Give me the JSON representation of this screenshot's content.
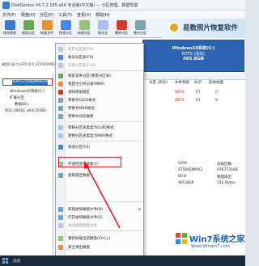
{
  "window": {
    "title": "DiskGenius V4.7.2.155 x64 专业版(中文版) — 分区管理、数据恢复"
  },
  "menubar": [
    "文件(F)",
    "硬盘(D)",
    "分区(P)",
    "工具(T)",
    "查看(V)",
    "帮助(H)"
  ],
  "toolbar": [
    "保存更改",
    "搜索分区",
    "恢复文件",
    "快速分区",
    "新建分区",
    "格式化",
    "删除分区",
    "备份分区"
  ],
  "banner": {
    "text": "易数照片恢复软件"
  },
  "disk_info": "硬盘0 接口:SATA 型号:ST500DM002 容量:465.8GB",
  "partition_bar": {
    "line1": "Windows10系统(C:)",
    "line2": "NTFS (活动)",
    "line3": "465.8GB"
  },
  "tree": {
    "disk0": "HD0:ST500DM002(466GB)",
    "items": [
      "Windows10系统(C:)",
      "扩展分区",
      "数据(D:)",
      "RD1:18501 x64(15GB)"
    ]
  },
  "grid": {
    "headers": [
      "分区 (状态)",
      "文件系统",
      "标识",
      "起始柱面"
    ],
    "rows": [
      {
        "fs": "NTFS",
        "id": "07",
        "start": "0"
      },
      {
        "fs": "NTFS",
        "id": "07",
        "start": "9"
      }
    ]
  },
  "details": {
    "labels": [
      "SATA",
      "ST500DM002",
      "60.8",
      "465.8GB"
    ],
    "values": [
      "总扇区数:",
      "976773168",
      "物理扇区:",
      "512 Bytes"
    ]
  },
  "context_menu": {
    "items": [
      {
        "label": "保存分区表(F8)",
        "enabled": false
      },
      {
        "label": "备份分区表(F9)",
        "enabled": true
      },
      {
        "label": "还原分区表(F10)",
        "enabled": false
      },
      {
        "label": "搜索丢失分区(重建分区表)",
        "enabled": true
      },
      {
        "label": "重建主引导记录(MBR)",
        "enabled": true
      },
      {
        "label": "清除保留扇区",
        "enabled": true
      },
      {
        "label": "转换为GUID格式",
        "enabled": true
      },
      {
        "label": "转换为MBR格式",
        "enabled": true
      },
      {
        "label": "转换为动态磁盘",
        "enabled": true
      },
      {
        "label": "转换分区表类型为GUID格式",
        "enabled": true
      },
      {
        "label": "转换分区表类型为MBR格式",
        "enabled": true
      },
      {
        "label": "快速分区(F6)",
        "enabled": true
      },
      {
        "label": "坏道检测与修复(Y)",
        "enabled": true
      },
      {
        "label": "复制扇区数据",
        "enabled": true
      },
      {
        "label": "新建虚拟磁盘文件(N)",
        "enabled": true
      },
      {
        "label": "打开虚拟磁盘文件(V)",
        "enabled": true
      },
      {
        "label": "关闭虚拟磁盘文件",
        "enabled": false
      },
      {
        "label": "重新加载当前硬盘(Ctrl_L)",
        "enabled": true
      },
      {
        "label": "安全弹出磁盘",
        "enabled": true
      }
    ]
  },
  "status": "就绪",
  "watermark": {
    "brand": "Win7系统之家",
    "url": "Www.Winwin7.com"
  },
  "colors": {
    "highlight": "#e02020",
    "partition": "#2d64b4",
    "accent": "#1662b6"
  }
}
